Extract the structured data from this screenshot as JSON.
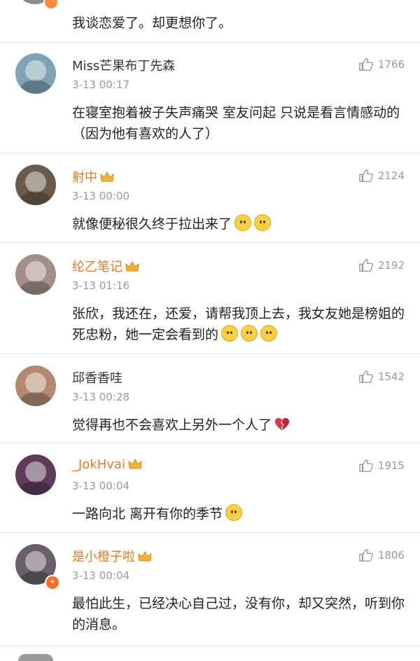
{
  "top_comment": {
    "text": "我谈恋爱了。却更想你了。"
  },
  "comments": [
    {
      "username": "Miss芒果布丁先森",
      "vip": false,
      "time": "3-13 00:17",
      "likes": "1766",
      "text": "在寝室抱着被子失声痛哭 室友问起 只说是看言情感动的（因为他有喜欢的人了）",
      "avatar_color": "#7fa3b5"
    },
    {
      "username": "射中",
      "vip": true,
      "time": "3-13 00:00",
      "likes": "2124",
      "text": "就像便秘很久终于拉出来了",
      "emoji_count": 2,
      "avatar_color": "#6b5b4a"
    },
    {
      "username": "纶乙笔记",
      "vip": true,
      "time": "3-13 01:16",
      "likes": "2192",
      "text": "张欣，我还在，还爱，请帮我顶上去，我女友她是榜姐的死忠粉，她一定会看到的",
      "emoji_count": 3,
      "avatar_color": "#a28f86"
    },
    {
      "username": "邱香香哇",
      "vip": false,
      "time": "3-13 00:28",
      "likes": "1542",
      "text": "觉得再也不会喜欢上另外一个人了",
      "broken_heart": true,
      "avatar_color": "#b28a72"
    },
    {
      "username": "_JokHvai",
      "vip": true,
      "time": "3-13 00:04",
      "likes": "1915",
      "text": "一路向北 离开有你的季节",
      "emoji_count": 1,
      "avatar_color": "#5e3b59"
    },
    {
      "username": "是小橙子啦",
      "vip": true,
      "time": "3-13 00:04",
      "likes": "1806",
      "text": "最怕此生，已经决心自己过，没有你，却又突然，听到你的消息。",
      "avatar_color": "#6a5f6a",
      "avatar_badge": true
    }
  ],
  "colors": {
    "vip_name": "#ea7a27",
    "meta_gray": "#9a9a9a",
    "divider": "#e6e6e6"
  },
  "icons": {
    "like": "thumbs-up-outline-icon",
    "vip": "crown-vip-icon",
    "emoji": "smile-emoji-icon",
    "heart": "broken-heart-icon"
  }
}
